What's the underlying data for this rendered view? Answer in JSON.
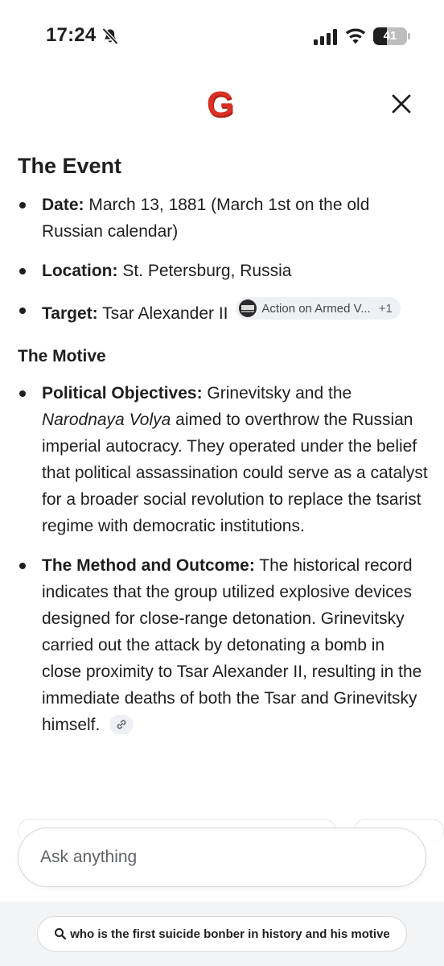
{
  "status_bar": {
    "time": "17:24",
    "battery": "41",
    "battery_fraction": 0.41,
    "icons": [
      "bell-slash-icon",
      "cellular-signal-icon",
      "wifi-icon",
      "battery-icon"
    ]
  },
  "header": {
    "logo_letter": "G",
    "logo_color": "#d93025",
    "close_icon": "close-icon"
  },
  "event_section": {
    "title": "The Event",
    "items": [
      {
        "label": "Date:",
        "text": "March 13, 1881 (March 1st on the old Russian calendar)"
      },
      {
        "label": "Location:",
        "text": "St. Petersburg, Russia"
      },
      {
        "label": "Target:",
        "text": "Tsar Alexander II",
        "chip": {
          "label": "Action on Armed V...",
          "count": "+1"
        }
      }
    ]
  },
  "motive_section": {
    "title": "The Motive",
    "items": [
      {
        "label": "Political Objectives:",
        "text_before": "Grinevitsky and the",
        "italic": "Narodnaya Volya",
        "text_after": "aimed to overthrow the Russian imperial autocracy. They operated under the belief that political assassination could serve as a catalyst for a broader social revolution to replace the tsarist regime with democratic institutions."
      },
      {
        "label": "The Method and Outcome:",
        "text": "The historical record indicates that the group utilized explosive devices designed for close-range detonation. Grinevitsky carried out the attack by detonating a bomb in close proximity to Tsar Alexander II, resulting in the immediate deaths of both the Tsar and Grinevitsky himself."
      }
    ]
  },
  "ask_input": {
    "placeholder": "Ask anything"
  },
  "query_pill": {
    "icon": "search-icon",
    "text": "who is the first suicide bonber in history and his motive"
  }
}
